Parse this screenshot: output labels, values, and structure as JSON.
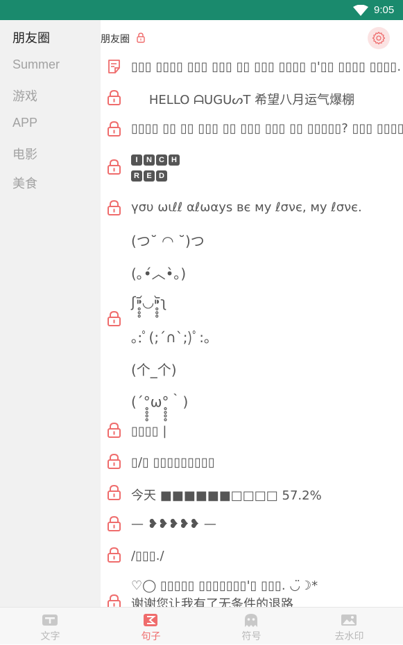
{
  "status_bar": {
    "time": "9:05"
  },
  "sidebar": {
    "items": [
      {
        "label": "朋友圈",
        "active": true
      },
      {
        "label": "Summer",
        "active": false
      },
      {
        "label": "游戏",
        "active": false
      },
      {
        "label": "APP",
        "active": false
      },
      {
        "label": "电影",
        "active": false
      },
      {
        "label": "美食",
        "active": false
      }
    ]
  },
  "header": {
    "title": "朋友圈"
  },
  "rows": [
    {
      "icon": "note-icon",
      "text": "▯▯▯ ▯▯▯▯ ▯▯▯ ▯▯▯ ▯▯ ▯▯▯ ▯▯▯▯ ▯'▯▯ ▯▯▯▯ ▯▯▯▯."
    },
    {
      "icon": "lock-icon",
      "text": "HELLO ᗩUGUᔕT 希望八月运气爆棚"
    },
    {
      "icon": "lock-icon",
      "text": "▯▯▯▯ ▯▯ ▯▯ ▯▯▯ ▯▯ ▯▯▯ ▯▯▯ ▯▯ ▯▯▯▯▯? ▯▯▯ ▯▯▯▯▯."
    },
    {
      "icon": "lock-icon",
      "tiles_line1": [
        "I",
        "N",
        "C",
        "H"
      ],
      "tiles_line2": [
        "R",
        "E",
        "D"
      ]
    },
    {
      "icon": "lock-icon",
      "text": "үσυ ωιℓℓ αℓωαуѕ вє му ℓσνє, му ℓσνє."
    },
    {
      "icon": "lock-icon",
      "lines": [
        "(つ˘ ◠ ˘)つ",
        "(｡•́︿•̀｡)",
        "ʃ⁍̥̥̥᷄◟◞⁍̥̥̥᷅ʅ",
        "｡:ﾟ(;´∩`;)ﾟ:｡",
        "(个_个)",
        "(´°̥̥̥̥ω°̥̥̥̥｀)"
      ]
    },
    {
      "icon": "lock-icon",
      "text": "▯▯▯▯ |"
    },
    {
      "icon": "lock-icon",
      "text": "▯/▯ ▯▯▯▯▯▯▯▯▯"
    },
    {
      "icon": "lock-icon",
      "text": "今天 ■■■■■■□□□□ 57.2%"
    },
    {
      "icon": "lock-icon",
      "text": "—      ❥❥❥❥❥      —"
    },
    {
      "icon": "lock-icon",
      "text": "/▯▯▯./"
    },
    {
      "icon": "lock-icon",
      "text": "♡◯ ▯▯▯▯▯ ▯▯▯▯▯▯▯'▯ ▯▯▯. ◡̈☽*",
      "text2": "谢谢您让我有了无条件的退路"
    }
  ],
  "bottom_nav": [
    {
      "label": "文字",
      "icon": "text-icon",
      "active": false
    },
    {
      "label": "句子",
      "icon": "sentence-icon",
      "active": true
    },
    {
      "label": "符号",
      "icon": "ghost-icon",
      "active": false
    },
    {
      "label": "去水印",
      "icon": "image-icon",
      "active": false
    }
  ],
  "colors": {
    "status_bar": "#1a8a6d",
    "accent": "#ef6c6c",
    "sidebar_bg": "#f1f1f1"
  }
}
